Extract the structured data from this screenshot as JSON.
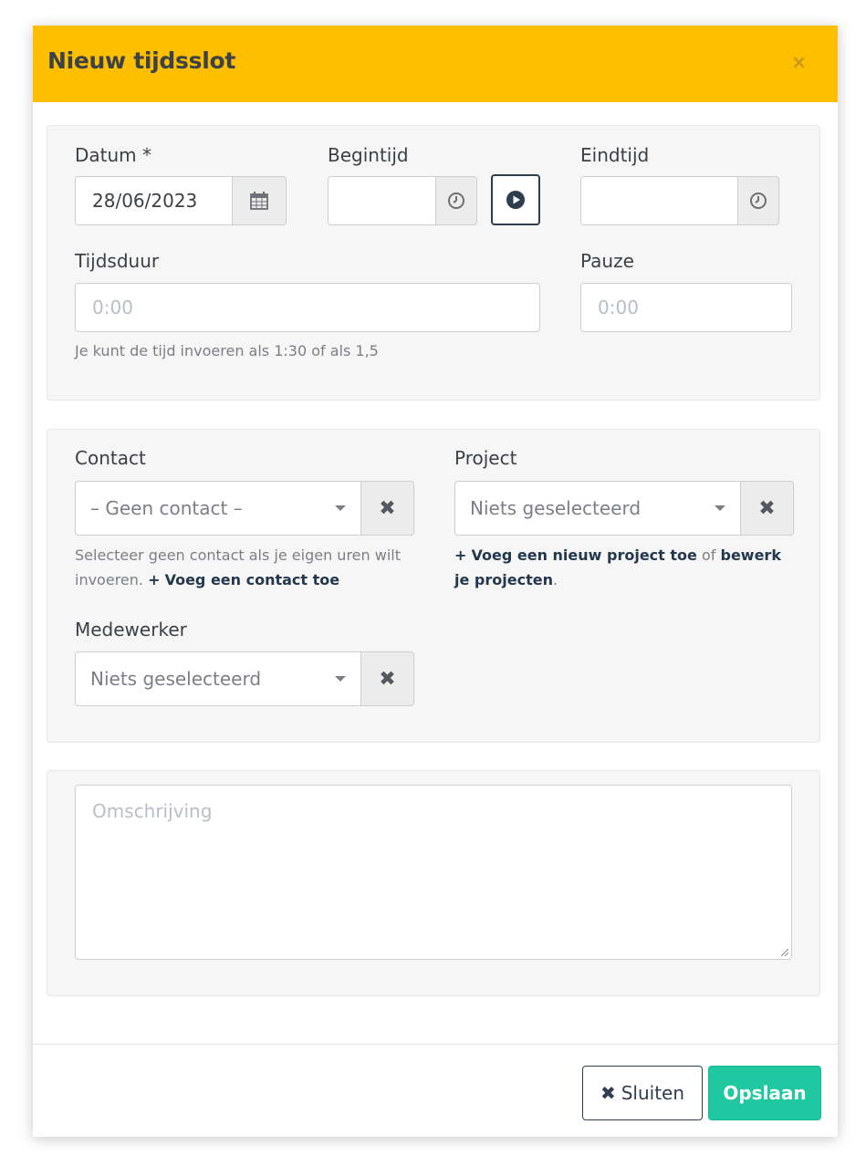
{
  "modal": {
    "title": "Nieuw tijdsslot",
    "close_symbol": "×"
  },
  "time": {
    "date_label": "Datum *",
    "date_value": "28/06/2023",
    "start_label": "Begintijd",
    "start_value": "",
    "end_label": "Eindtijd",
    "end_value": "",
    "duration_label": "Tijdsduur",
    "duration_placeholder": "0:00",
    "pause_label": "Pauze",
    "pause_placeholder": "0:00",
    "help_text": "Je kunt de tijd invoeren als 1:30 of als 1,5"
  },
  "relations": {
    "contact_label": "Contact",
    "contact_value": "– Geen contact –",
    "contact_help": "Selecteer geen contact als je eigen uren wilt invoeren.",
    "add_contact_link": "Voeg een contact toe",
    "project_label": "Project",
    "project_value": "Niets geselecteerd",
    "add_project_link": "Voeg een nieuw project toe",
    "project_help_or": "of",
    "edit_projects_link": "bewerk je projecten",
    "project_help_end": ".",
    "employee_label": "Medewerker",
    "employee_value": "Niets geselecteerd"
  },
  "description": {
    "placeholder": "Omschrijving"
  },
  "footer": {
    "close_label": "Sluiten",
    "save_label": "Opslaan"
  },
  "colors": {
    "header_bg": "#fdbf00",
    "save_bg": "#1fc8a0",
    "link": "#23384d"
  },
  "icons": [
    "calendar-icon",
    "clock-icon",
    "play-circle-icon",
    "times-icon",
    "plus-icon",
    "caret-down-icon"
  ]
}
